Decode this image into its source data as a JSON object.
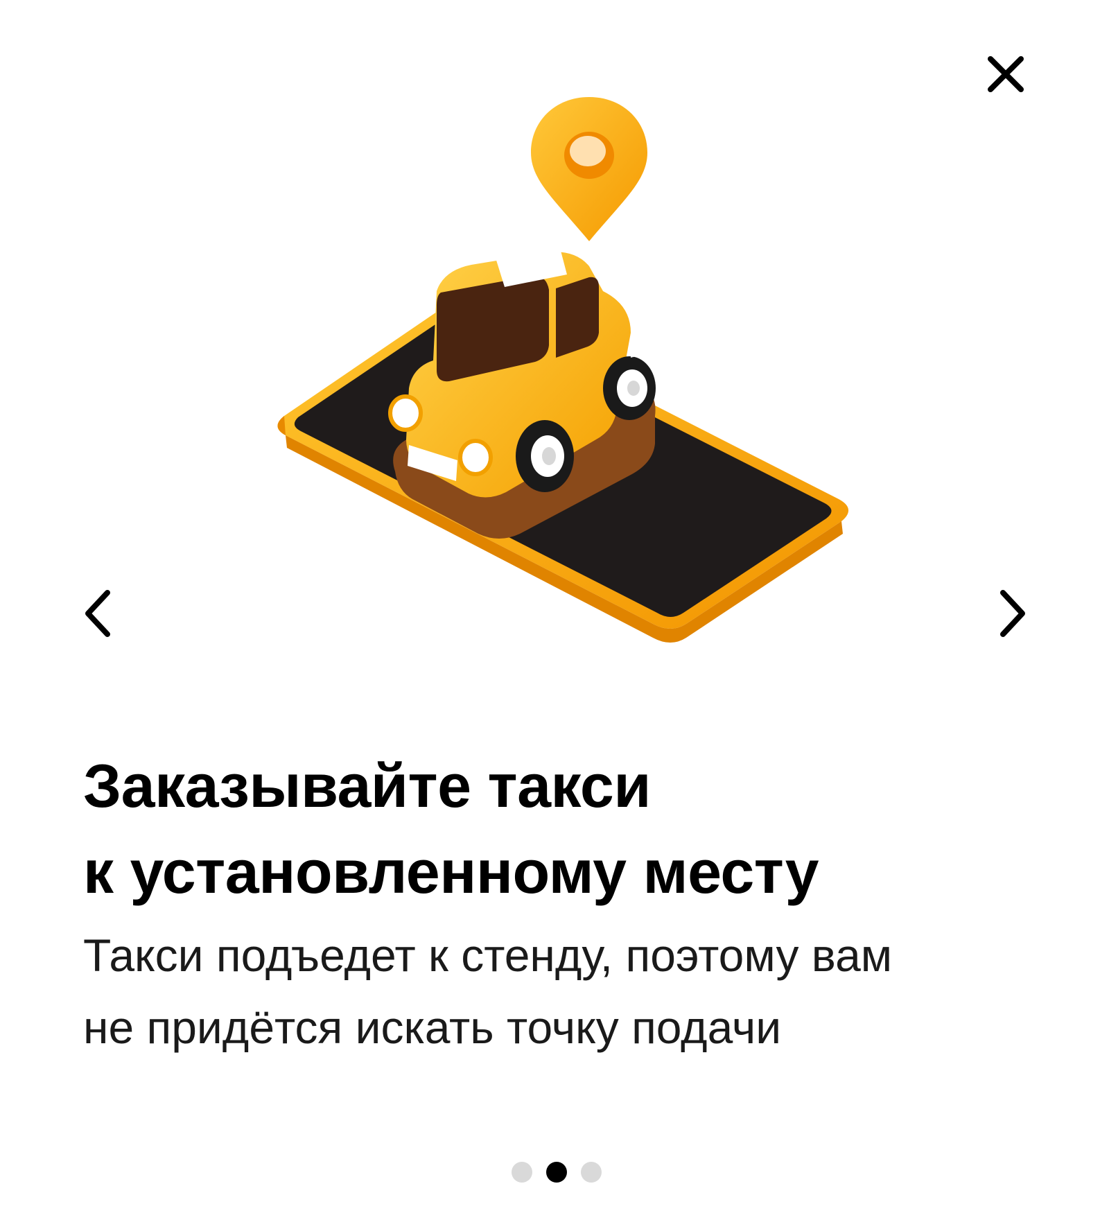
{
  "onboarding": {
    "title_lines": [
      "Заказывайте такси",
      "к установленному месту"
    ],
    "description_lines": [
      "Такси подъедет к стенду, поэтому вам",
      "не придётся искать точку подачи"
    ],
    "pagination": {
      "total": 3,
      "current": 2
    }
  },
  "icons": {
    "close": "close-icon",
    "prev": "chevron-left-icon",
    "next": "chevron-right-icon",
    "illustration": "taxi-on-phone-with-location-pin"
  },
  "colors": {
    "accent_yellow": "#FFB300",
    "screen_black": "#1f1b1b",
    "text_primary": "#000000",
    "dot_inactive": "#d9d9d9",
    "dot_active": "#000000"
  }
}
